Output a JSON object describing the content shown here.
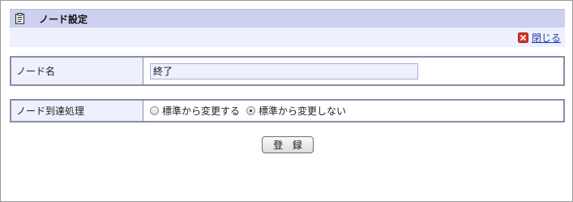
{
  "dialog": {
    "title": "ノード設定",
    "close_label": "閉じる"
  },
  "node_name": {
    "label": "ノード名",
    "value": "終了"
  },
  "arrival_processing": {
    "label": "ノード到達処理",
    "options": [
      {
        "label": "標準から変更する",
        "selected": false
      },
      {
        "label": "標準から変更しない",
        "selected": true
      }
    ]
  },
  "actions": {
    "submit_label": "登 録"
  },
  "colors": {
    "header_bg": "#cdd0ee",
    "subbar_bg": "#eef0fd",
    "link": "#1f3fa8",
    "close_icon": "#d9352b"
  }
}
